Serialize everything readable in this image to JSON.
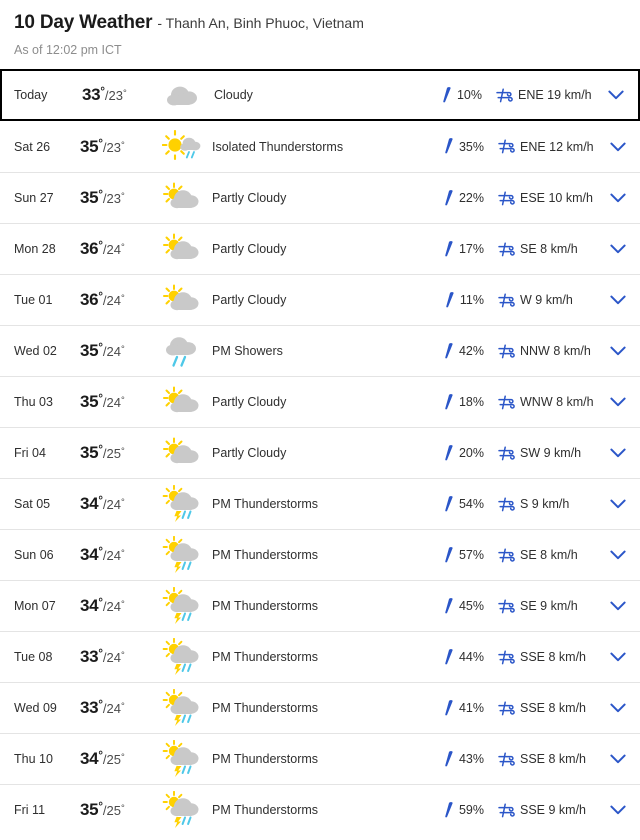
{
  "header": {
    "title": "10 Day Weather",
    "location": "- Thanh An, Binh Phuoc, Vietnam",
    "as_of": "As of 12:02 pm ICT"
  },
  "colors": {
    "accent_blue": "#2b56c8",
    "sun_yellow": "#ffd100",
    "cloud_gray": "#c7c7c7",
    "rain_cyan": "#4ec8e8",
    "text_dark": "#2f2f2f",
    "today_border": "#000000"
  },
  "icons": {
    "precip": "raindrop-icon",
    "wind": "wind-icon",
    "expand": "chevron-down-icon"
  },
  "days": [
    {
      "day": "Today",
      "high": "33",
      "low": "23",
      "deg": "°",
      "sep": "/",
      "condition": "Cloudy",
      "icon": "cloudy-icon",
      "precip": "10%",
      "wind": "ENE 19 km/h",
      "today": true
    },
    {
      "day": "Sat 26",
      "high": "35",
      "low": "23",
      "deg": "°",
      "sep": "/",
      "condition": "Isolated Thunderstorms",
      "icon": "sun-cloud-rain-icon",
      "precip": "35%",
      "wind": "ENE 12 km/h",
      "today": false
    },
    {
      "day": "Sun 27",
      "high": "35",
      "low": "23",
      "deg": "°",
      "sep": "/",
      "condition": "Partly Cloudy",
      "icon": "partly-cloudy-icon",
      "precip": "22%",
      "wind": "ESE 10 km/h",
      "today": false
    },
    {
      "day": "Mon 28",
      "high": "36",
      "low": "24",
      "deg": "°",
      "sep": "/",
      "condition": "Partly Cloudy",
      "icon": "partly-cloudy-icon",
      "precip": "17%",
      "wind": "SE 8 km/h",
      "today": false
    },
    {
      "day": "Tue 01",
      "high": "36",
      "low": "24",
      "deg": "°",
      "sep": "/",
      "condition": "Partly Cloudy",
      "icon": "partly-cloudy-icon",
      "precip": "11%",
      "wind": "W 9 km/h",
      "today": false
    },
    {
      "day": "Wed 02",
      "high": "35",
      "low": "24",
      "deg": "°",
      "sep": "/",
      "condition": "PM Showers",
      "icon": "rain-showers-icon",
      "precip": "42%",
      "wind": "NNW 8 km/h",
      "today": false
    },
    {
      "day": "Thu 03",
      "high": "35",
      "low": "24",
      "deg": "°",
      "sep": "/",
      "condition": "Partly Cloudy",
      "icon": "partly-cloudy-icon",
      "precip": "18%",
      "wind": "WNW 8 km/h",
      "today": false
    },
    {
      "day": "Fri 04",
      "high": "35",
      "low": "25",
      "deg": "°",
      "sep": "/",
      "condition": "Partly Cloudy",
      "icon": "partly-cloudy-icon",
      "precip": "20%",
      "wind": "SW 9 km/h",
      "today": false
    },
    {
      "day": "Sat 05",
      "high": "34",
      "low": "24",
      "deg": "°",
      "sep": "/",
      "condition": "PM Thunderstorms",
      "icon": "thunderstorm-icon",
      "precip": "54%",
      "wind": "S 9 km/h",
      "today": false
    },
    {
      "day": "Sun 06",
      "high": "34",
      "low": "24",
      "deg": "°",
      "sep": "/",
      "condition": "PM Thunderstorms",
      "icon": "thunderstorm-icon",
      "precip": "57%",
      "wind": "SE 8 km/h",
      "today": false
    },
    {
      "day": "Mon 07",
      "high": "34",
      "low": "24",
      "deg": "°",
      "sep": "/",
      "condition": "PM Thunderstorms",
      "icon": "thunderstorm-icon",
      "precip": "45%",
      "wind": "SE 9 km/h",
      "today": false
    },
    {
      "day": "Tue 08",
      "high": "33",
      "low": "24",
      "deg": "°",
      "sep": "/",
      "condition": "PM Thunderstorms",
      "icon": "thunderstorm-icon",
      "precip": "44%",
      "wind": "SSE 8 km/h",
      "today": false
    },
    {
      "day": "Wed 09",
      "high": "33",
      "low": "24",
      "deg": "°",
      "sep": "/",
      "condition": "PM Thunderstorms",
      "icon": "thunderstorm-icon",
      "precip": "41%",
      "wind": "SSE 8 km/h",
      "today": false
    },
    {
      "day": "Thu 10",
      "high": "34",
      "low": "25",
      "deg": "°",
      "sep": "/",
      "condition": "PM Thunderstorms",
      "icon": "thunderstorm-icon",
      "precip": "43%",
      "wind": "SSE 8 km/h",
      "today": false
    },
    {
      "day": "Fri 11",
      "high": "35",
      "low": "25",
      "deg": "°",
      "sep": "/",
      "condition": "PM Thunderstorms",
      "icon": "thunderstorm-icon",
      "precip": "59%",
      "wind": "SSE 9 km/h",
      "today": false
    }
  ]
}
